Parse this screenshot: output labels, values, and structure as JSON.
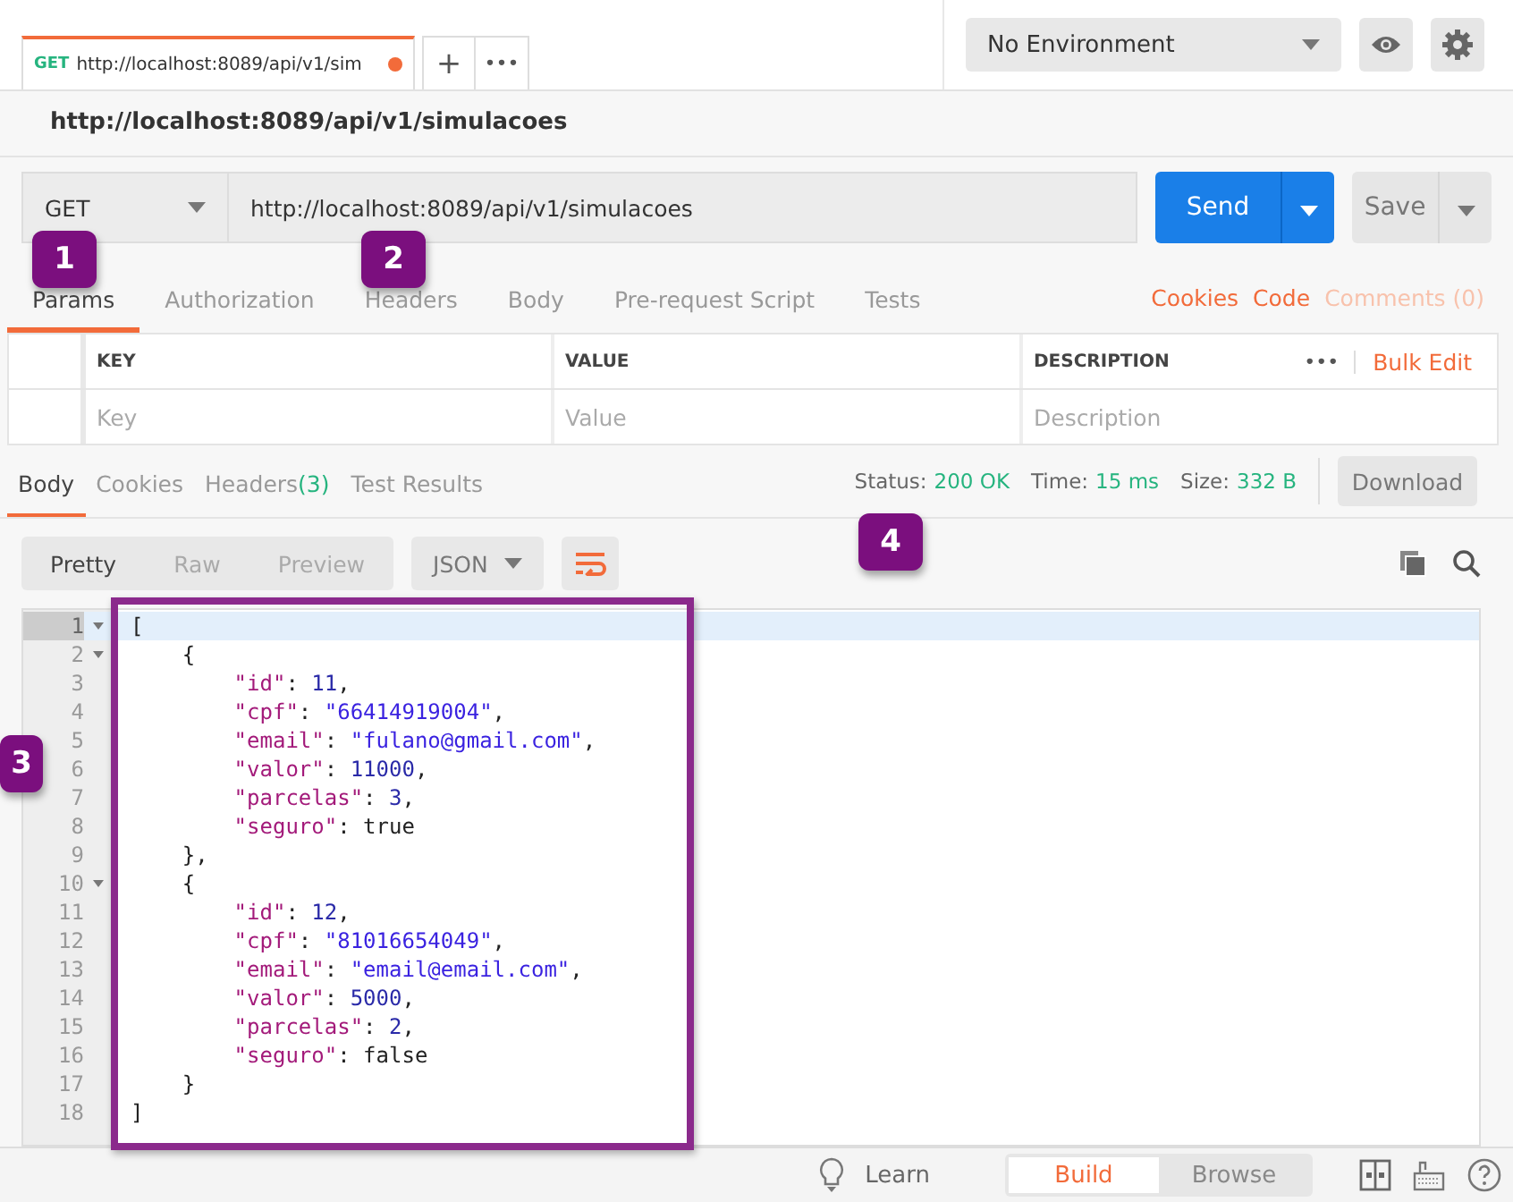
{
  "request_tabs": [
    {
      "method": "GET",
      "title": "http://localhost:8089/api/v1/sim",
      "unsaved": true,
      "selected": true
    }
  ],
  "tab_actions": {
    "add": "+",
    "more": "•••"
  },
  "environment": {
    "value": "No Environment"
  },
  "request_name": "http://localhost:8089/api/v1/simulacoes",
  "request": {
    "method": "GET",
    "url": "http://localhost:8089/api/v1/simulacoes",
    "send": "Send",
    "save": "Save"
  },
  "request_sections": [
    {
      "label": "Params",
      "selected": true
    },
    {
      "label": "Authorization",
      "selected": false
    },
    {
      "label": "Headers",
      "selected": false
    },
    {
      "label": "Body",
      "selected": false
    },
    {
      "label": "Pre-request Script",
      "selected": false
    },
    {
      "label": "Tests",
      "selected": false
    }
  ],
  "request_links": [
    {
      "label": "Cookies",
      "disabled": false
    },
    {
      "label": "Code",
      "disabled": false
    },
    {
      "label": "Comments (0)",
      "disabled": true
    }
  ],
  "params_table": {
    "columns": [
      "KEY",
      "VALUE",
      "DESCRIPTION"
    ],
    "more": "•••",
    "bulk_edit": "Bulk Edit",
    "placeholders": [
      "Key",
      "Value",
      "Description"
    ]
  },
  "response_tabs": [
    {
      "label": "Body",
      "selected": true
    },
    {
      "label": "Cookies",
      "selected": false
    },
    {
      "label": "Headers",
      "count": "(3)",
      "selected": false
    },
    {
      "label": "Test Results",
      "selected": false
    }
  ],
  "response_meta": [
    {
      "label": "Status:",
      "value": "200 OK"
    },
    {
      "label": "Time:",
      "value": "15 ms"
    },
    {
      "label": "Size:",
      "value": "332 B"
    }
  ],
  "download": "Download",
  "view_modes": [
    {
      "label": "Pretty",
      "selected": true
    },
    {
      "label": "Raw",
      "selected": false
    },
    {
      "label": "Preview",
      "selected": false
    }
  ],
  "format": "JSON",
  "code_lines": [
    {
      "number": "1",
      "fold": true,
      "highlighted": true,
      "tokens": [
        {
          "kind": "punct",
          "text": "["
        }
      ]
    },
    {
      "number": "2",
      "fold": true,
      "highlighted": false,
      "tokens": [
        {
          "kind": "punct",
          "text": "    {"
        }
      ]
    },
    {
      "number": "3",
      "fold": false,
      "highlighted": false,
      "tokens": [
        {
          "kind": "key",
          "text": "        \"id\""
        },
        {
          "kind": "punct",
          "text": ": "
        },
        {
          "kind": "num",
          "text": "11"
        },
        {
          "kind": "punct",
          "text": ","
        }
      ]
    },
    {
      "number": "4",
      "fold": false,
      "highlighted": false,
      "tokens": [
        {
          "kind": "key",
          "text": "        \"cpf\""
        },
        {
          "kind": "punct",
          "text": ": "
        },
        {
          "kind": "str",
          "text": "\"66414919004\""
        },
        {
          "kind": "punct",
          "text": ","
        }
      ]
    },
    {
      "number": "5",
      "fold": false,
      "highlighted": false,
      "tokens": [
        {
          "kind": "key",
          "text": "        \"email\""
        },
        {
          "kind": "punct",
          "text": ": "
        },
        {
          "kind": "str",
          "text": "\"fulano@gmail.com\""
        },
        {
          "kind": "punct",
          "text": ","
        }
      ]
    },
    {
      "number": "6",
      "fold": false,
      "highlighted": false,
      "tokens": [
        {
          "kind": "key",
          "text": "        \"valor\""
        },
        {
          "kind": "punct",
          "text": ": "
        },
        {
          "kind": "num",
          "text": "11000"
        },
        {
          "kind": "punct",
          "text": ","
        }
      ]
    },
    {
      "number": "7",
      "fold": false,
      "highlighted": false,
      "tokens": [
        {
          "kind": "key",
          "text": "        \"parcelas\""
        },
        {
          "kind": "punct",
          "text": ": "
        },
        {
          "kind": "num",
          "text": "3"
        },
        {
          "kind": "punct",
          "text": ","
        }
      ]
    },
    {
      "number": "8",
      "fold": false,
      "highlighted": false,
      "tokens": [
        {
          "kind": "key",
          "text": "        \"seguro\""
        },
        {
          "kind": "punct",
          "text": ": true"
        }
      ]
    },
    {
      "number": "9",
      "fold": false,
      "highlighted": false,
      "tokens": [
        {
          "kind": "punct",
          "text": "    },"
        }
      ]
    },
    {
      "number": "10",
      "fold": true,
      "highlighted": false,
      "tokens": [
        {
          "kind": "punct",
          "text": "    {"
        }
      ]
    },
    {
      "number": "11",
      "fold": false,
      "highlighted": false,
      "tokens": [
        {
          "kind": "key",
          "text": "        \"id\""
        },
        {
          "kind": "punct",
          "text": ": "
        },
        {
          "kind": "num",
          "text": "12"
        },
        {
          "kind": "punct",
          "text": ","
        }
      ]
    },
    {
      "number": "12",
      "fold": false,
      "highlighted": false,
      "tokens": [
        {
          "kind": "key",
          "text": "        \"cpf\""
        },
        {
          "kind": "punct",
          "text": ": "
        },
        {
          "kind": "str",
          "text": "\"81016654049\""
        },
        {
          "kind": "punct",
          "text": ","
        }
      ]
    },
    {
      "number": "13",
      "fold": false,
      "highlighted": false,
      "tokens": [
        {
          "kind": "key",
          "text": "        \"email\""
        },
        {
          "kind": "punct",
          "text": ": "
        },
        {
          "kind": "str",
          "text": "\"email@email.com\""
        },
        {
          "kind": "punct",
          "text": ","
        }
      ]
    },
    {
      "number": "14",
      "fold": false,
      "highlighted": false,
      "tokens": [
        {
          "kind": "key",
          "text": "        \"valor\""
        },
        {
          "kind": "punct",
          "text": ": "
        },
        {
          "kind": "num",
          "text": "5000"
        },
        {
          "kind": "punct",
          "text": ","
        }
      ]
    },
    {
      "number": "15",
      "fold": false,
      "highlighted": false,
      "tokens": [
        {
          "kind": "key",
          "text": "        \"parcelas\""
        },
        {
          "kind": "punct",
          "text": ": "
        },
        {
          "kind": "num",
          "text": "2"
        },
        {
          "kind": "punct",
          "text": ","
        }
      ]
    },
    {
      "number": "16",
      "fold": false,
      "highlighted": false,
      "tokens": [
        {
          "kind": "key",
          "text": "        \"seguro\""
        },
        {
          "kind": "punct",
          "text": ": false"
        }
      ]
    },
    {
      "number": "17",
      "fold": false,
      "highlighted": false,
      "tokens": [
        {
          "kind": "punct",
          "text": "    }"
        }
      ]
    },
    {
      "number": "18",
      "fold": false,
      "highlighted": false,
      "tokens": [
        {
          "kind": "punct",
          "text": "]"
        }
      ]
    }
  ],
  "callouts": [
    "1",
    "2",
    "3",
    "4"
  ],
  "footer": {
    "learn": "Learn",
    "modes": [
      {
        "label": "Build",
        "selected": true
      },
      {
        "label": "Browse",
        "selected": false
      }
    ]
  }
}
